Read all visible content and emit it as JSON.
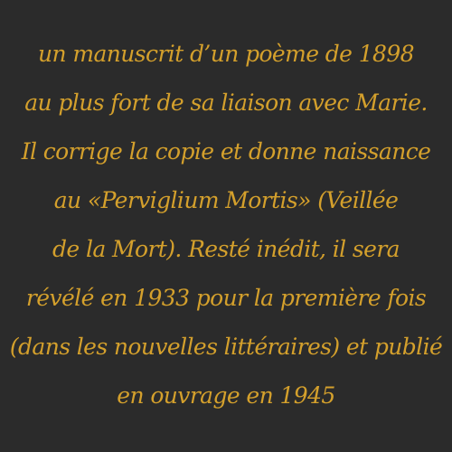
{
  "background_color": "#2b2b2b",
  "text_color": "#d4a02c",
  "lines": [
    "un manuscrit d’un poème de 1898",
    "au plus fort de sa liaison avec Marie.",
    "Il corrige la copie et donne naissance",
    "au «Perviglium Mortis» (Veillée",
    "de la Mort). Resté inédit, il sera",
    "révélé en 1933 pour la première fois",
    "(dans les nouvelles littéraires) et publié",
    "en ouvrage en 1945"
  ]
}
